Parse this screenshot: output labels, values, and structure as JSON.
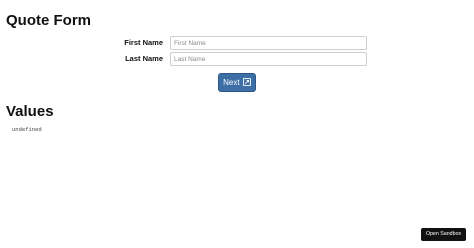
{
  "form": {
    "title": "Quote Form",
    "fields": [
      {
        "label": "First Name",
        "placeholder": "First Name",
        "value": ""
      },
      {
        "label": "Last Name",
        "placeholder": "Last Name",
        "value": ""
      }
    ],
    "next_label": "Next",
    "next_icon": "external-link-icon"
  },
  "values": {
    "title": "Values",
    "output": "undefined"
  },
  "sandbox": {
    "button_label": "Open Sandbox"
  },
  "colors": {
    "primary_button": "#3d6ea6",
    "sandbox_button": "#111111"
  }
}
